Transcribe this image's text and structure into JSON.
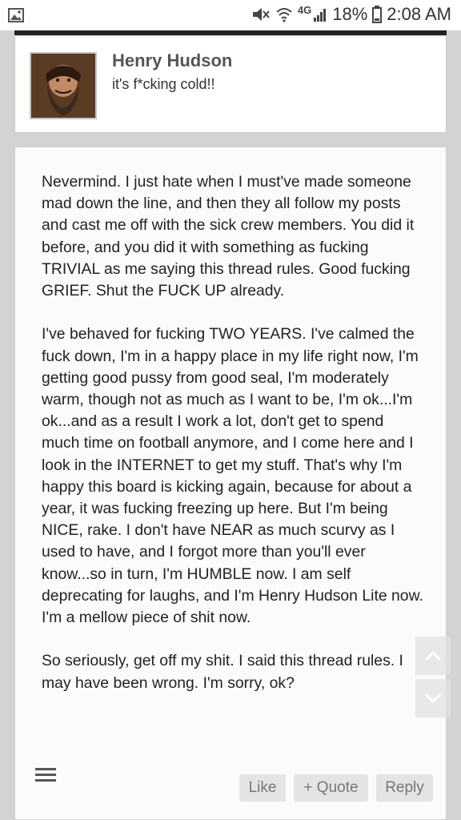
{
  "status_bar": {
    "network": "4G",
    "battery": "18%",
    "time": "2:08 AM"
  },
  "author": {
    "name": "Henry Hudson",
    "title": "it's f*cking cold!!"
  },
  "post": {
    "paragraphs": [
      "Nevermind. I just hate when I must've made someone mad down the line, and then they all follow my posts and cast me off with the sick crew members. You did it before, and you did it with something as fucking TRIVIAL as me saying this thread rules. Good fucking GRIEF. Shut the FUCK UP already.",
      "I've behaved for fucking TWO YEARS. I've calmed the fuck down, I'm in a happy place in my life right now, I'm getting good pussy from good seal, I'm moderately warm, though not as much as I want to be, I'm ok...I'm ok...and as a result I work a lot, don't get to spend much time on football anymore, and I come here and I look in the INTERNET to get my stuff. That's why I'm happy this board is kicking again, because for about a year, it was fucking freezing up here. But I'm being NICE, rake. I don't have NEAR as much scurvy as I used to have, and I forgot more than you'll ever know...so in turn, I'm HUMBLE now. I am self deprecating for laughs, and I'm Henry Hudson Lite now. I'm a mellow piece of shit now.",
      "So seriously, get off my shit. I said this thread rules. I may have been wrong. I'm sorry, ok?"
    ]
  },
  "actions": {
    "like": "Like",
    "quote": "+ Quote",
    "reply": "Reply"
  },
  "icons": {
    "gallery": "image-icon",
    "mute": "mute-icon",
    "wifi": "wifi-icon",
    "signal": "signal-icon",
    "battery": "battery-icon",
    "menu": "menu-icon",
    "scroll_up": "chevron-up-icon",
    "scroll_down": "chevron-down-icon"
  }
}
